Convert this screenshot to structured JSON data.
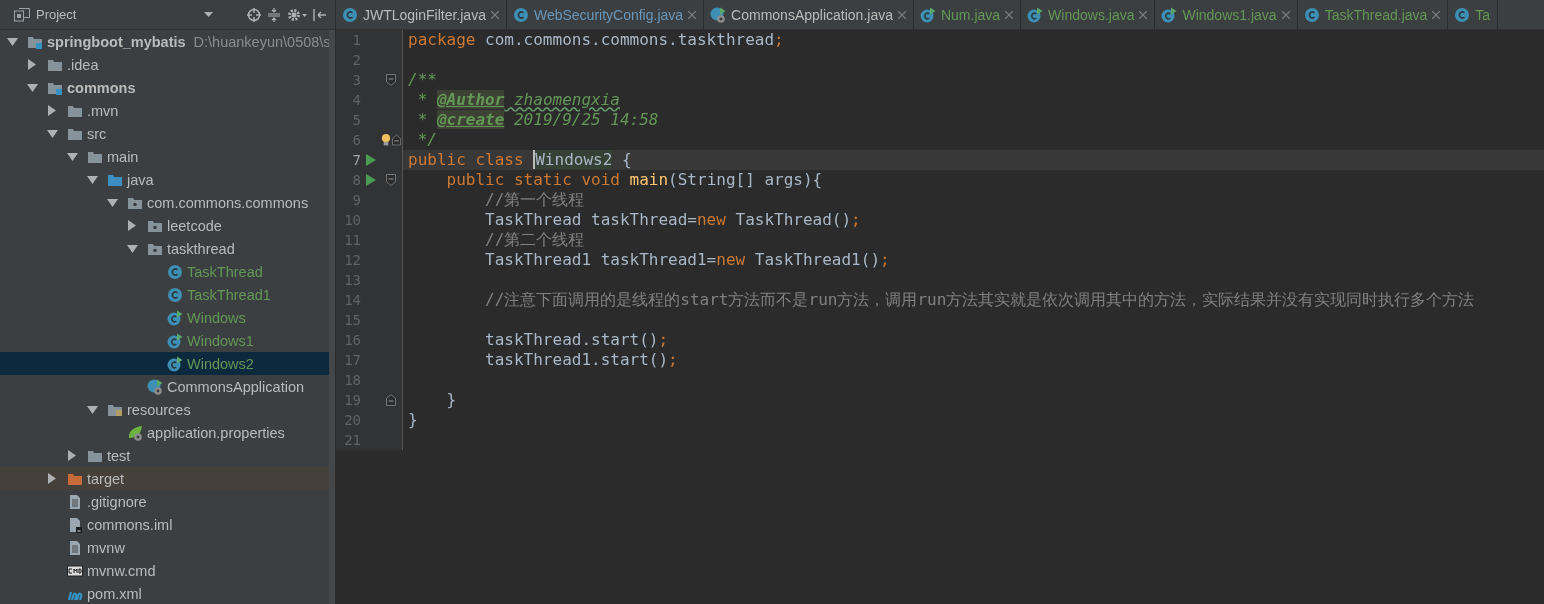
{
  "project_panel": {
    "title": "Project",
    "tree": [
      {
        "label": "springboot_mybatis",
        "path": "D:\\huankeyun\\0508\\s",
        "kind": "module",
        "expanded": true,
        "selected": false,
        "children": [
          {
            "label": ".idea",
            "kind": "folder",
            "expanded": false,
            "selected": false
          },
          {
            "label": "commons",
            "kind": "module",
            "expanded": true,
            "selected": false,
            "children": [
              {
                "label": ".mvn",
                "kind": "folder",
                "expanded": false,
                "selected": false
              },
              {
                "label": "src",
                "kind": "folder",
                "expanded": true,
                "selected": false,
                "children": [
                  {
                    "label": "main",
                    "kind": "folder",
                    "expanded": true,
                    "selected": false,
                    "children": [
                      {
                        "label": "java",
                        "kind": "source_folder",
                        "expanded": true,
                        "selected": false,
                        "children": [
                          {
                            "label": "com.commons.commons",
                            "kind": "package",
                            "expanded": true,
                            "selected": false,
                            "children": [
                              {
                                "label": "leetcode",
                                "kind": "package",
                                "expanded": false,
                                "selected": false
                              },
                              {
                                "label": "taskthread",
                                "kind": "package",
                                "expanded": true,
                                "selected": false,
                                "children": [
                                  {
                                    "label": "TaskThread",
                                    "kind": "class",
                                    "color": "#629755",
                                    "selected": false
                                  },
                                  {
                                    "label": "TaskThread1",
                                    "kind": "class",
                                    "color": "#629755",
                                    "selected": false
                                  },
                                  {
                                    "label": "Windows",
                                    "kind": "runnable_class",
                                    "color": "#629755",
                                    "selected": false
                                  },
                                  {
                                    "label": "Windows1",
                                    "kind": "runnable_class",
                                    "color": "#629755",
                                    "selected": false
                                  },
                                  {
                                    "label": "Windows2",
                                    "kind": "runnable_class",
                                    "color": "#629755",
                                    "selected": true
                                  }
                                ]
                              },
                              {
                                "label": "CommonsApplication",
                                "kind": "spring_app",
                                "selected": false
                              }
                            ]
                          }
                        ]
                      },
                      {
                        "label": "resources",
                        "kind": "resource_folder",
                        "expanded": true,
                        "selected": false,
                        "children": [
                          {
                            "label": "application.properties",
                            "kind": "spring_properties",
                            "selected": false
                          }
                        ]
                      }
                    ]
                  },
                  {
                    "label": "test",
                    "kind": "folder",
                    "expanded": false,
                    "selected": false
                  }
                ]
              },
              {
                "label": "target",
                "kind": "excluded_folder",
                "expanded": false,
                "selected": false
              },
              {
                "label": ".gitignore",
                "kind": "text_file",
                "selected": false
              },
              {
                "label": "commons.iml",
                "kind": "iml_file",
                "selected": false
              },
              {
                "label": "mvnw",
                "kind": "text_file",
                "selected": false
              },
              {
                "label": "mvnw.cmd",
                "kind": "cmd_file",
                "selected": false
              },
              {
                "label": "pom.xml",
                "kind": "maven_file",
                "selected": false
              }
            ]
          }
        ]
      }
    ]
  },
  "tabs": [
    {
      "label": "JWTLoginFilter.java",
      "kind": "class",
      "closable": true
    },
    {
      "label": "WebSecurityConfig.java",
      "kind": "class",
      "color": "#6897bb",
      "closable": true
    },
    {
      "label": "CommonsApplication.java",
      "kind": "spring_app",
      "closable": true
    },
    {
      "label": "Num.java",
      "kind": "runnable_class",
      "color": "#629755",
      "closable": true
    },
    {
      "label": "Windows.java",
      "kind": "runnable_class",
      "color": "#629755",
      "closable": true
    },
    {
      "label": "Windows1.java",
      "kind": "runnable_class",
      "color": "#629755",
      "closable": true
    },
    {
      "label": "TaskThread.java",
      "kind": "class",
      "color": "#629755",
      "closable": true
    },
    {
      "label": "Ta",
      "kind": "class",
      "color": "#629755",
      "closable": false
    }
  ],
  "editor": {
    "lines": [
      {
        "number": "1",
        "tokens": [
          {
            "kind": "keyword",
            "text": "package "
          },
          {
            "kind": "text",
            "text": "com.commons.commons.taskthread"
          },
          {
            "kind": "keyword",
            "text": ";"
          }
        ]
      },
      {
        "number": "2"
      },
      {
        "number": "3",
        "fold_start": true,
        "tokens": [
          {
            "kind": "doc",
            "text": "/**"
          }
        ]
      },
      {
        "number": "4",
        "tokens": [
          {
            "kind": "doc",
            "text": " * "
          },
          {
            "kind": "doctag",
            "text": "@Author"
          },
          {
            "kind": "doc_typo",
            "text": " zhaomengxia"
          }
        ]
      },
      {
        "number": "5",
        "tokens": [
          {
            "kind": "doc",
            "text": " * "
          },
          {
            "kind": "doctag",
            "text": "@create"
          },
          {
            "kind": "doc",
            "text": " 2019/9/25 14:58"
          }
        ]
      },
      {
        "number": "6",
        "fold_end": true,
        "bulb": true,
        "tokens": [
          {
            "kind": "doc",
            "text": " */"
          }
        ]
      },
      {
        "number": "7",
        "run": true,
        "current": true,
        "tokens": [
          {
            "kind": "keyword",
            "text": "public class "
          },
          {
            "kind": "highlight",
            "text": "Windows2"
          },
          {
            "kind": "text",
            "text": " {"
          }
        ]
      },
      {
        "number": "8",
        "run": true,
        "fold_start": true,
        "tokens": [
          {
            "kind": "keyword",
            "text": "    public static void "
          },
          {
            "kind": "method",
            "text": "main"
          },
          {
            "kind": "text",
            "text": "(String[] args){"
          }
        ]
      },
      {
        "number": "9",
        "tokens": [
          {
            "kind": "comment",
            "text": "        //第一个线程"
          }
        ]
      },
      {
        "number": "10",
        "tokens": [
          {
            "kind": "text",
            "text": "        TaskThread taskThread="
          },
          {
            "kind": "keyword",
            "text": "new "
          },
          {
            "kind": "text",
            "text": "TaskThread()"
          },
          {
            "kind": "keyword",
            "text": ";"
          }
        ]
      },
      {
        "number": "11",
        "tokens": [
          {
            "kind": "comment",
            "text": "        //第二个线程"
          }
        ]
      },
      {
        "number": "12",
        "tokens": [
          {
            "kind": "text",
            "text": "        TaskThread1 taskThread1="
          },
          {
            "kind": "keyword",
            "text": "new "
          },
          {
            "kind": "text",
            "text": "TaskThread1()"
          },
          {
            "kind": "keyword",
            "text": ";"
          }
        ]
      },
      {
        "number": "13"
      },
      {
        "number": "14",
        "tokens": [
          {
            "kind": "comment",
            "text": "        //注意下面调用的是线程的start方法而不是run方法，调用run方法其实就是依次调用其中的方法，实际结果并没有实现同时执行多个方法"
          }
        ]
      },
      {
        "number": "15"
      },
      {
        "number": "16",
        "tokens": [
          {
            "kind": "text",
            "text": "        taskThread.start()"
          },
          {
            "kind": "keyword",
            "text": ";"
          }
        ]
      },
      {
        "number": "17",
        "tokens": [
          {
            "kind": "text",
            "text": "        taskThread1.start()"
          },
          {
            "kind": "keyword",
            "text": ";"
          }
        ]
      },
      {
        "number": "18"
      },
      {
        "number": "19",
        "fold_end": true,
        "tokens": [
          {
            "kind": "text",
            "text": "    }"
          }
        ]
      },
      {
        "number": "20",
        "tokens": [
          {
            "kind": "text",
            "text": "}"
          }
        ]
      },
      {
        "number": "21"
      }
    ]
  }
}
